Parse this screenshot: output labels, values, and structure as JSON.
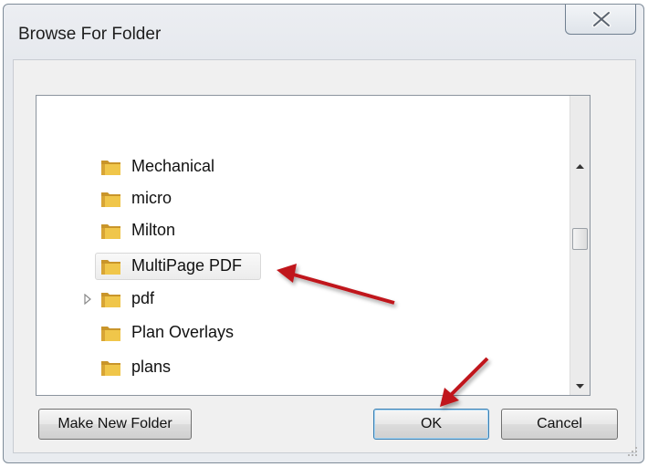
{
  "window": {
    "title": "Browse For Folder"
  },
  "tree": {
    "items": [
      {
        "label": "Mechanical",
        "expandable": false,
        "selected": false
      },
      {
        "label": "micro",
        "expandable": false,
        "selected": false
      },
      {
        "label": "Milton",
        "expandable": false,
        "selected": false
      },
      {
        "label": "MultiPage PDF",
        "expandable": false,
        "selected": true
      },
      {
        "label": "pdf",
        "expandable": true,
        "selected": false
      },
      {
        "label": "Plan Overlays",
        "expandable": false,
        "selected": false
      },
      {
        "label": "plans",
        "expandable": false,
        "selected": false
      }
    ]
  },
  "buttons": {
    "make_new_folder": "Make New Folder",
    "ok": "OK",
    "cancel": "Cancel"
  },
  "colors": {
    "folder": "#e8b93a",
    "annotation_arrow": "#c0161b",
    "ok_border": "#3c7fb1"
  },
  "icons": {
    "close": "close-icon",
    "folder": "folder-icon",
    "expander": "expand-triangle-icon",
    "scroll_up": "scroll-up-arrow-icon",
    "scroll_down": "scroll-down-arrow-icon",
    "resize": "resize-grip-icon"
  }
}
